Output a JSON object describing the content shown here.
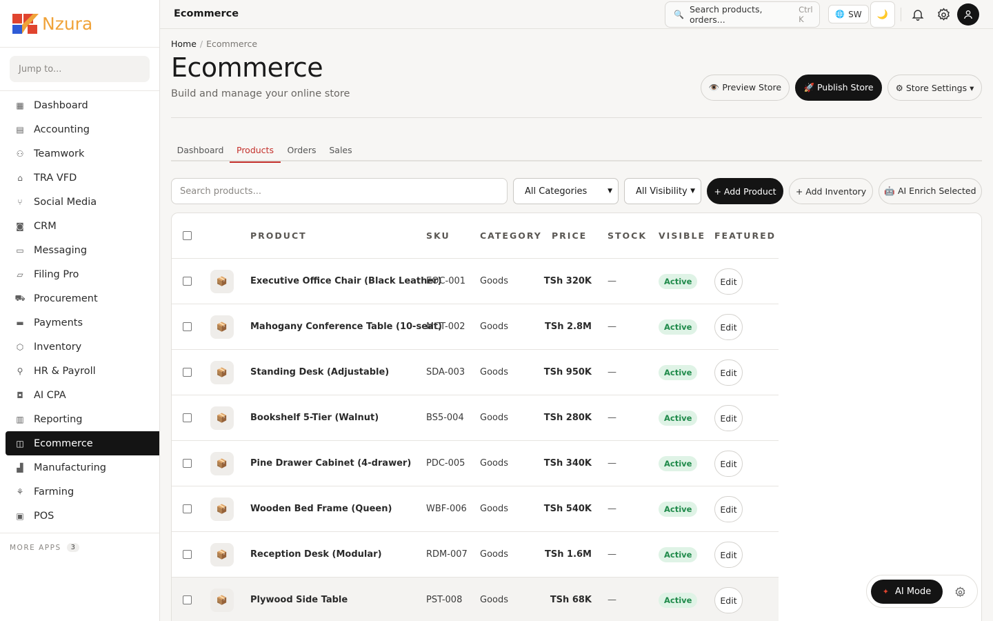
{
  "brand": {
    "name": "Nzura",
    "colors": {
      "red": "#e0442f",
      "blue": "#2f5bd6",
      "orange": "#f0a33a"
    }
  },
  "sidebar": {
    "jump_placeholder": "Jump to...",
    "items": [
      {
        "label": "Dashboard",
        "icon": "grid-icon"
      },
      {
        "label": "Accounting",
        "icon": "ledger-icon"
      },
      {
        "label": "Teamwork",
        "icon": "people-icon"
      },
      {
        "label": "TRA VFD",
        "icon": "bank-icon"
      },
      {
        "label": "Social Media",
        "icon": "share-icon"
      },
      {
        "label": "CRM",
        "icon": "contact-icon"
      },
      {
        "label": "Messaging",
        "icon": "chat-icon"
      },
      {
        "label": "Filing Pro",
        "icon": "folder-icon"
      },
      {
        "label": "Procurement",
        "icon": "cart-icon"
      },
      {
        "label": "Payments",
        "icon": "card-icon"
      },
      {
        "label": "Inventory",
        "icon": "box-icon"
      },
      {
        "label": "HR & Payroll",
        "icon": "person-icon"
      },
      {
        "label": "AI CPA",
        "icon": "robot-icon"
      },
      {
        "label": "Reporting",
        "icon": "chart-icon"
      },
      {
        "label": "Ecommerce",
        "icon": "bag-icon",
        "active": true
      },
      {
        "label": "Manufacturing",
        "icon": "factory-icon"
      },
      {
        "label": "Farming",
        "icon": "sprout-icon"
      },
      {
        "label": "POS",
        "icon": "receipt-icon"
      }
    ],
    "more_apps_label": "MORE APPS",
    "more_apps_count": "3"
  },
  "topbar": {
    "title": "Ecommerce",
    "search_text": "Search products, orders...",
    "search_shortcut": "Ctrl K",
    "language": "SW"
  },
  "header": {
    "breadcrumb": {
      "home": "Home",
      "current": "Ecommerce"
    },
    "title": "Ecommerce",
    "subtitle": "Build and manage your online store",
    "buttons": {
      "preview": "👁️ Preview Store",
      "publish": "🚀 Publish Store",
      "settings": "⚙ Store Settings ▾"
    }
  },
  "tabs": [
    "Dashboard",
    "Products",
    "Orders",
    "Sales"
  ],
  "active_tab": "Products",
  "toolbar": {
    "search_placeholder": "Search products...",
    "category_select": "All Categories",
    "visibility_select": "All Visibility",
    "add_product": "+ Add Product",
    "add_inventory": "+ Add Inventory",
    "ai_enrich": "🤖 AI Enrich Selected"
  },
  "table": {
    "columns": [
      "PRODUCT",
      "SKU",
      "CATEGORY",
      "PRICE",
      "STOCK",
      "VISIBLE",
      "FEATURED"
    ],
    "rows": [
      {
        "name": "Executive Office Chair (Black Leather)",
        "sku": "EOC-001",
        "category": "Goods",
        "price": "TSh 320K",
        "stock": "—",
        "visible": "Active",
        "action": "Edit"
      },
      {
        "name": "Mahogany Conference Table (10-seat)",
        "sku": "MCT-002",
        "category": "Goods",
        "price": "TSh 2.8M",
        "stock": "—",
        "visible": "Active",
        "action": "Edit"
      },
      {
        "name": "Standing Desk (Adjustable)",
        "sku": "SDA-003",
        "category": "Goods",
        "price": "TSh 950K",
        "stock": "—",
        "visible": "Active",
        "action": "Edit"
      },
      {
        "name": "Bookshelf 5-Tier (Walnut)",
        "sku": "BS5-004",
        "category": "Goods",
        "price": "TSh 280K",
        "stock": "—",
        "visible": "Active",
        "action": "Edit"
      },
      {
        "name": "Pine Drawer Cabinet (4-drawer)",
        "sku": "PDC-005",
        "category": "Goods",
        "price": "TSh 340K",
        "stock": "—",
        "visible": "Active",
        "action": "Edit"
      },
      {
        "name": "Wooden Bed Frame (Queen)",
        "sku": "WBF-006",
        "category": "Goods",
        "price": "TSh 540K",
        "stock": "—",
        "visible": "Active",
        "action": "Edit"
      },
      {
        "name": "Reception Desk (Modular)",
        "sku": "RDM-007",
        "category": "Goods",
        "price": "TSh 1.6M",
        "stock": "—",
        "visible": "Active",
        "action": "Edit"
      },
      {
        "name": "Plywood Side Table",
        "sku": "PST-008",
        "category": "Goods",
        "price": "TSh 68K",
        "stock": "—",
        "visible": "Active",
        "action": "Edit"
      }
    ]
  },
  "ai_widget": {
    "label": "AI Mode"
  }
}
